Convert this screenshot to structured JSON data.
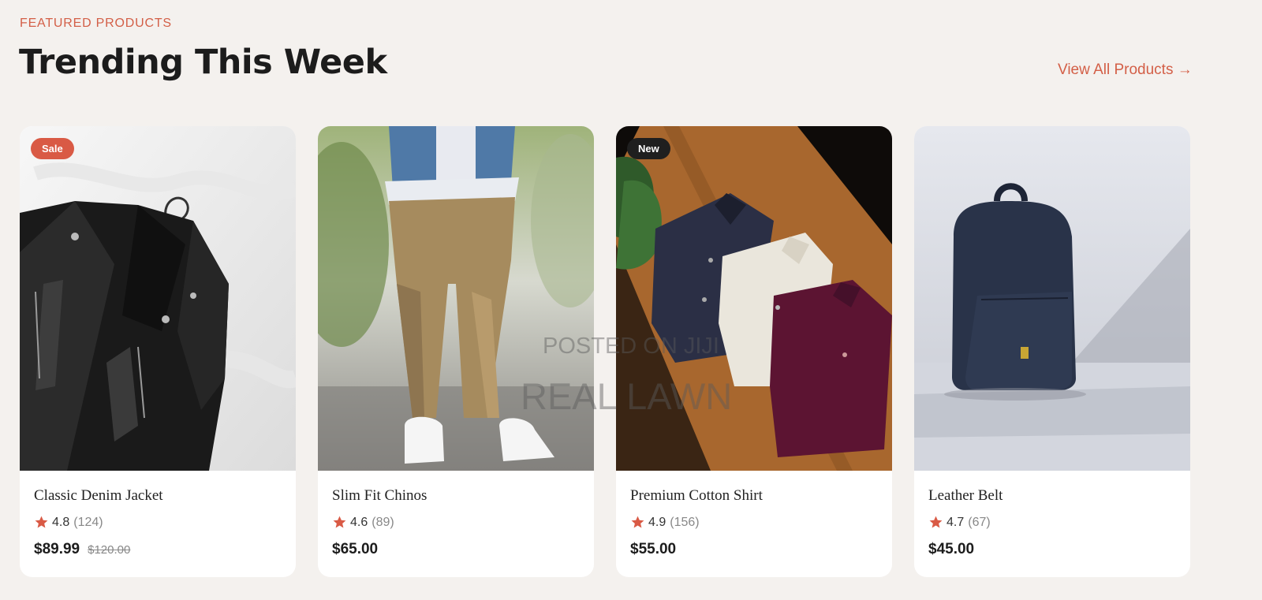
{
  "header": {
    "eyebrow": "FEATURED PRODUCTS",
    "title": "Trending This Week",
    "view_all": "View All Products →"
  },
  "colors": {
    "accent": "#d35f47",
    "sale_badge": "#d95a45",
    "new_badge": "#1f1f1f",
    "background": "#f4f1ee"
  },
  "products": [
    {
      "name": "Classic Denim Jacket",
      "badge": "Sale",
      "rating": "4.8",
      "reviews": "(124)",
      "price": "$89.99",
      "old_price": "$120.00",
      "icon": "leather-jacket-image"
    },
    {
      "name": "Slim Fit Chinos",
      "badge": "",
      "rating": "4.6",
      "reviews": "(89)",
      "price": "$65.00",
      "old_price": "",
      "icon": "chinos-image"
    },
    {
      "name": "Premium Cotton Shirt",
      "badge": "New",
      "rating": "4.9",
      "reviews": "(156)",
      "price": "$55.00",
      "old_price": "",
      "icon": "shirts-image"
    },
    {
      "name": "Leather Belt",
      "badge": "",
      "rating": "4.7",
      "reviews": "(67)",
      "price": "$45.00",
      "old_price": "",
      "icon": "backpack-image"
    }
  ],
  "watermark": {
    "line1": "POSTED ON JIJI",
    "line2": "REAL LAWN"
  }
}
